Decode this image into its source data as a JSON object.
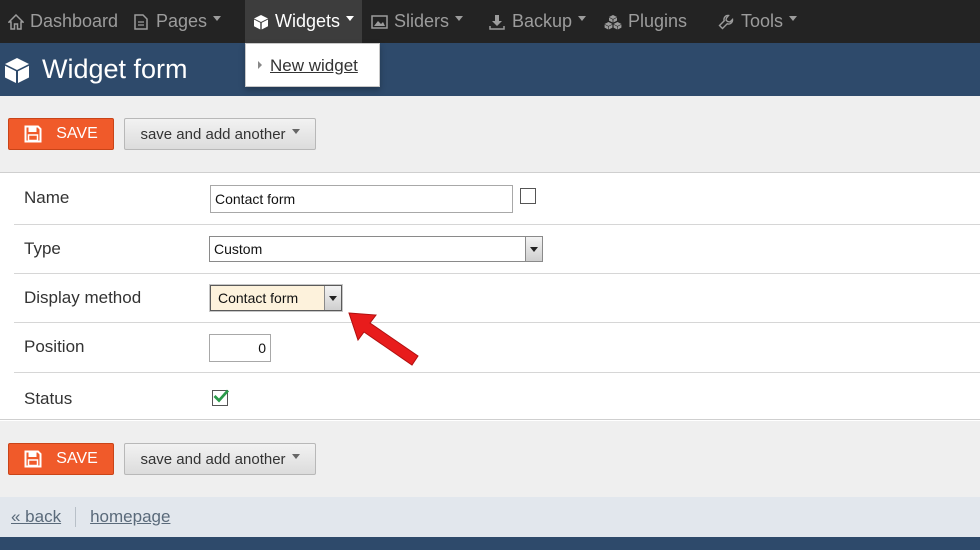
{
  "nav": {
    "items": [
      {
        "label": "Dashboard",
        "icon": "home-icon"
      },
      {
        "label": "Pages",
        "icon": "page-icon",
        "has_caret": true
      },
      {
        "label": "Widgets",
        "icon": "cube-icon",
        "has_caret": true,
        "active": true
      },
      {
        "label": "Sliders",
        "icon": "image-icon",
        "has_caret": true
      },
      {
        "label": "Backup",
        "icon": "download-icon",
        "has_caret": true
      },
      {
        "label": "Plugins",
        "icon": "cubes-icon"
      },
      {
        "label": "Tools",
        "icon": "wrench-icon",
        "has_caret": true
      }
    ],
    "dropdown_item": "New widget"
  },
  "header": {
    "title": "Widget form",
    "icon": "cube-icon"
  },
  "buttons": {
    "save_label": "SAVE",
    "save_and_add_label": "save and add another"
  },
  "form": {
    "name_label": "Name",
    "name_value": "Contact form",
    "name_checkbox_checked": false,
    "type_label": "Type",
    "type_value": "Custom",
    "display_label": "Display method",
    "display_value": "Contact form",
    "position_label": "Position",
    "position_value": "0",
    "status_label": "Status",
    "status_checked": true
  },
  "footer": {
    "back_label": "« back",
    "home_label": "homepage"
  },
  "colors": {
    "nav_bg": "#232323",
    "header_bg": "#2e4a6b",
    "save_bg": "#f05a2a",
    "annotation": "#e81c1c"
  }
}
